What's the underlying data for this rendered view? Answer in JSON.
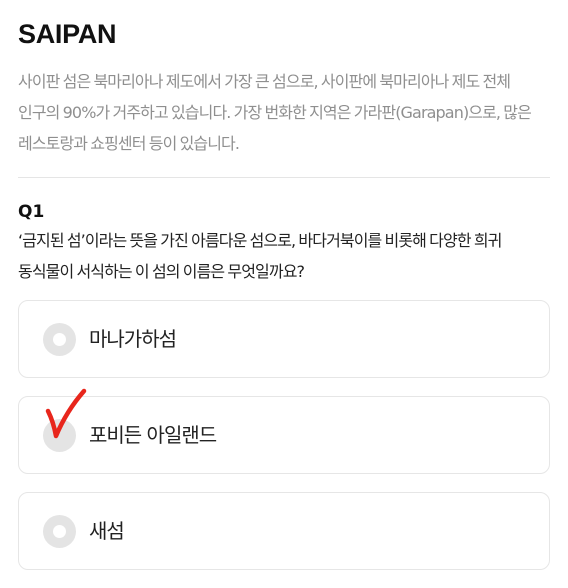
{
  "header": {
    "title": "SAIPAN"
  },
  "intro": {
    "description": "사이판 섬은 북마리아나 제도에서 가장 큰 섬으로, 사이판에 북마리아나 제도 전체 인구의 90%가 거주하고 있습니다. 가장 번화한 지역은 가라판(Garapan)으로, 많은 레스토랑과 쇼핑센터 등이 있습니다."
  },
  "question": {
    "number": "Q1",
    "text": "‘금지된 섬’이라는 뜻을 가진 아름다운 섬으로, 바다거북이를 비롯해 다양한 희귀 동식물이 서식하는 이 섬의 이름은 무엇일까요?",
    "options": [
      {
        "label": "마나가하섬",
        "checked": false
      },
      {
        "label": "포비든 아일랜드",
        "checked": true
      },
      {
        "label": "새섬",
        "checked": false
      }
    ]
  },
  "colors": {
    "checkmark": "#e8261c",
    "radio": "#e4e4e4",
    "description_text": "#8f8f8f",
    "border": "#e6e6e6"
  },
  "icons": {
    "checkmark": "handwritten-checkmark-icon"
  }
}
